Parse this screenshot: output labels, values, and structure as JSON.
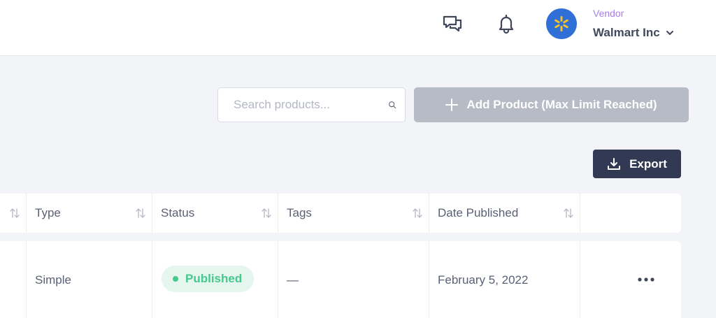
{
  "header": {
    "vendor_role": "Vendor",
    "vendor_name": "Walmart Inc",
    "icons": [
      "chat-icon",
      "bell-icon",
      "walmart-spark-icon",
      "chevron-down-icon"
    ]
  },
  "toolbar": {
    "search_placeholder": "Search products...",
    "search_value": "",
    "add_product_label": "Add Product (Max Limit Reached)",
    "export_label": "Export"
  },
  "table": {
    "columns": [
      "Type",
      "Status",
      "Tags",
      "Date Published"
    ],
    "rows": [
      {
        "type": "Simple",
        "status": "Published",
        "tags": "—",
        "date_published": "February 5, 2022"
      }
    ]
  },
  "colors": {
    "accent_purple": "#a77ee8",
    "export_button": "#313a52",
    "disabled_button": "#b7bbc6",
    "published_green": "#45c98e",
    "avatar_blue": "#2f6fd6",
    "spark_yellow": "#f7c325"
  }
}
